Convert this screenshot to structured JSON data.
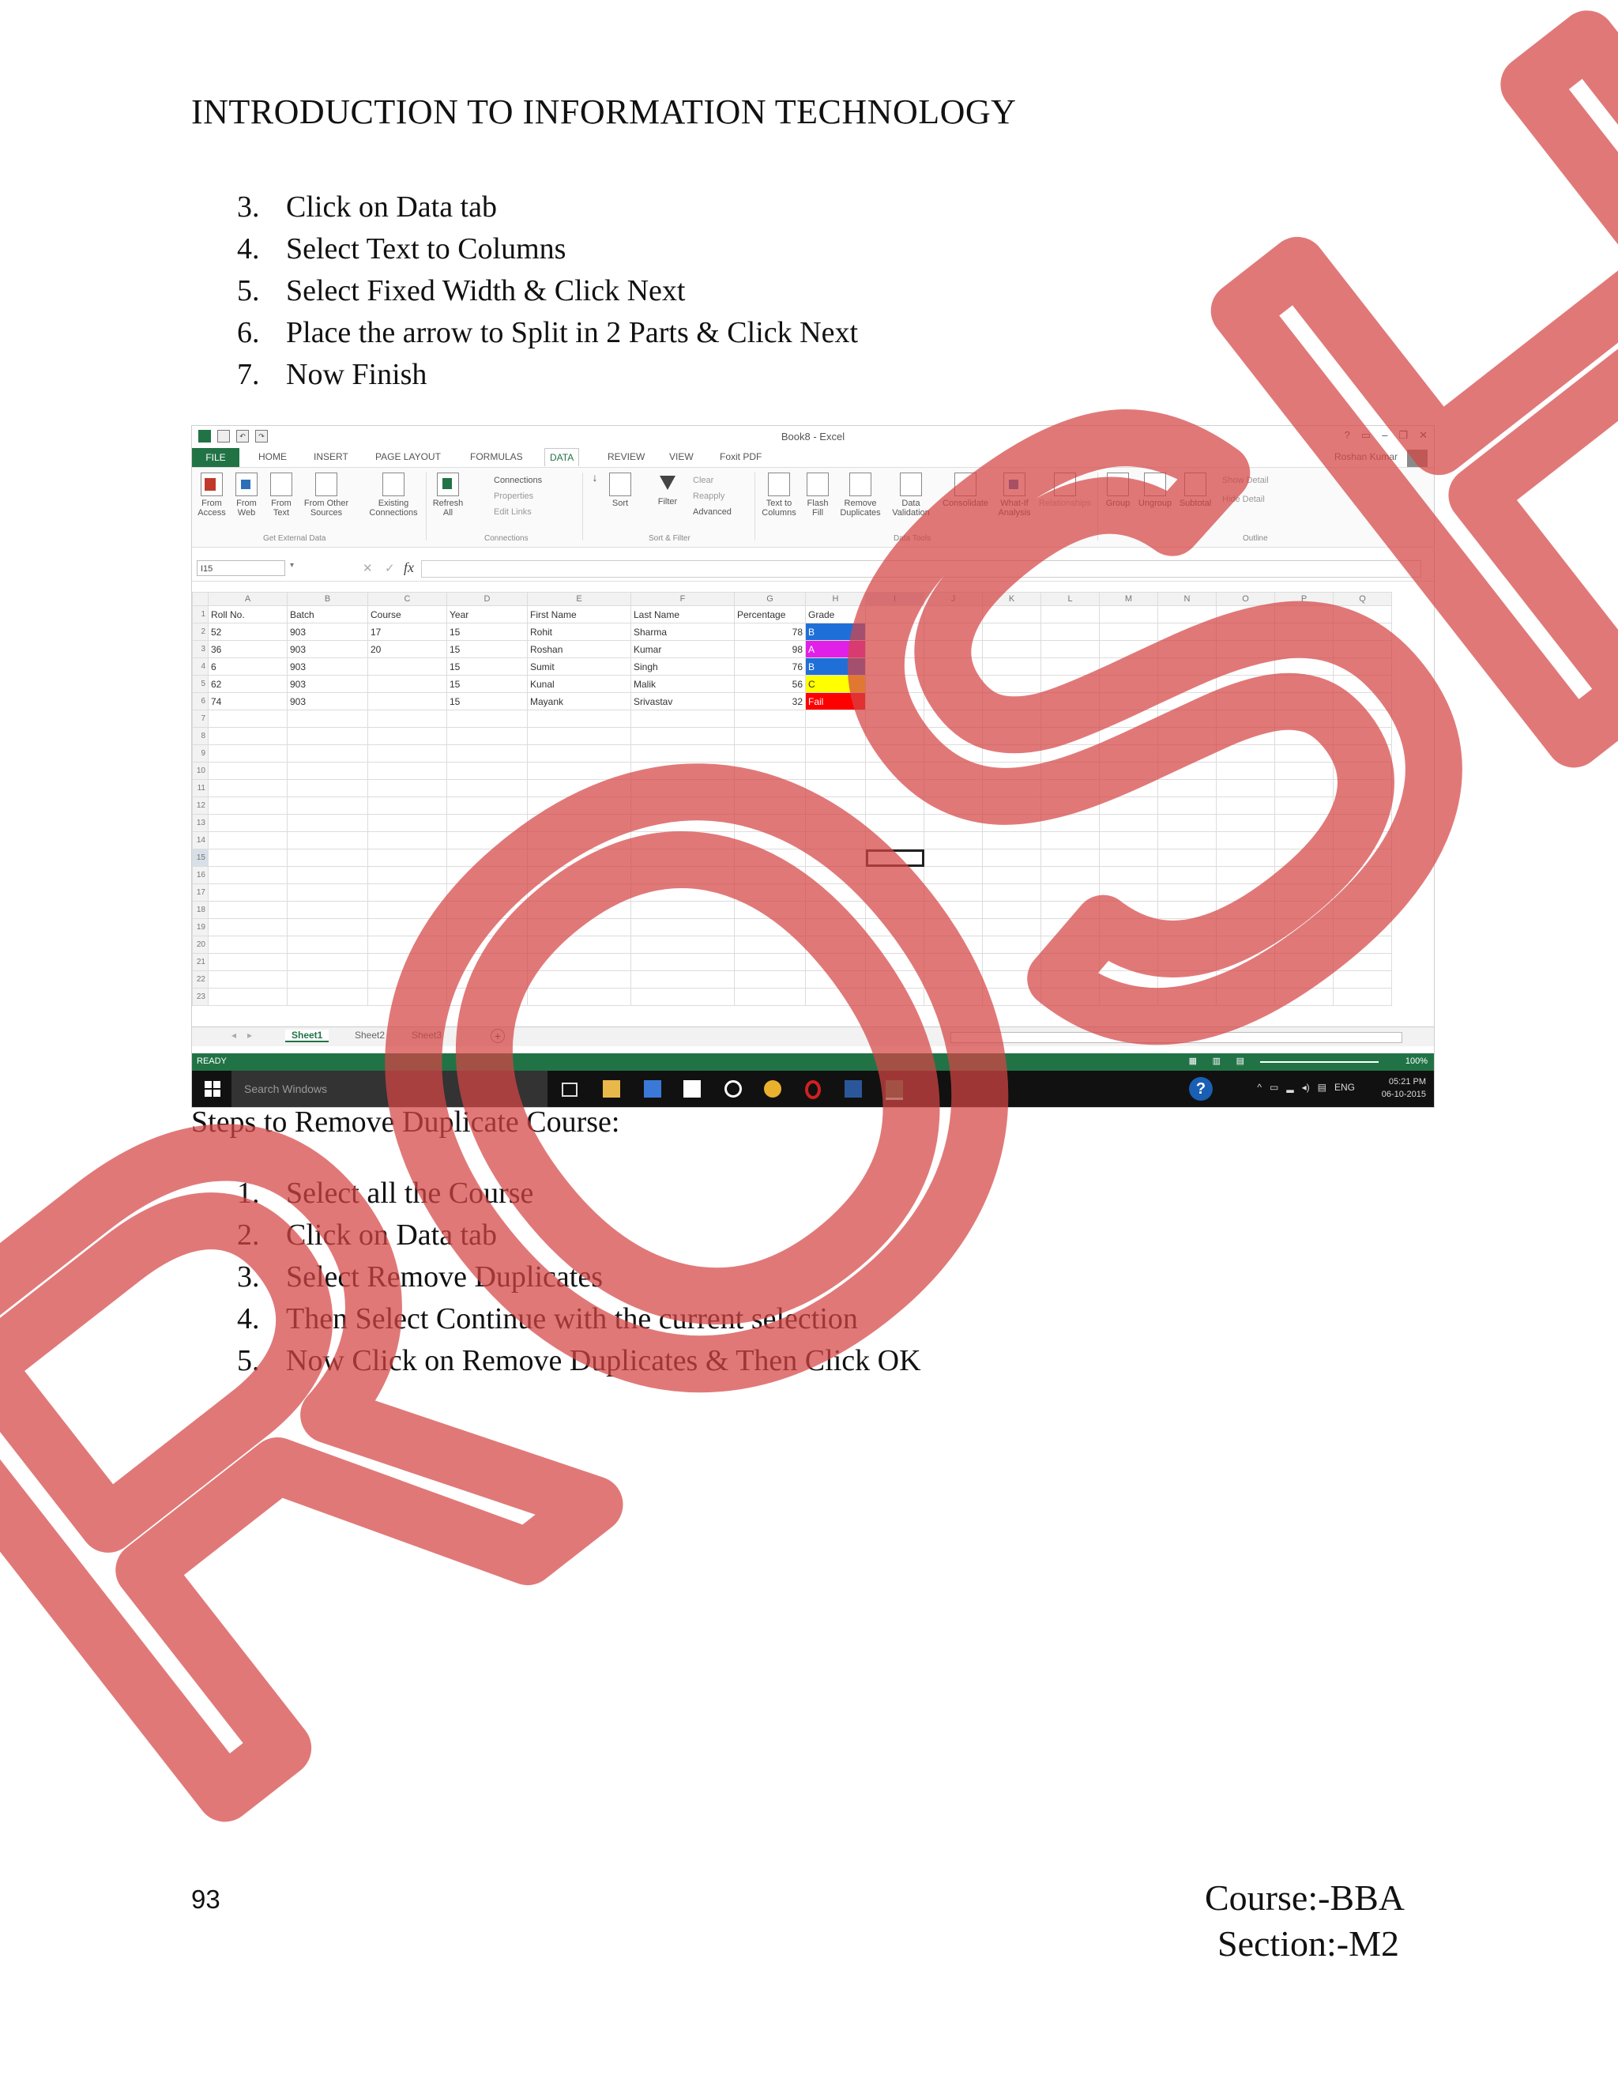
{
  "header": {
    "title": "INTRODUCTION TO INFORMATION TECHNOLOGY"
  },
  "steps_top": [
    {
      "num": "3.",
      "text": "Click  on Data tab"
    },
    {
      "num": "4.",
      "text": "Select Text to Columns"
    },
    {
      "num": "5.",
      "text": "Select Fixed  Width  & Click  Next"
    },
    {
      "num": "6.",
      "text": "Place  the arrow to Split  in 2 Parts & Click  Next"
    },
    {
      "num": "7.",
      "text": "Now Finish"
    }
  ],
  "excel": {
    "window_title": "Book8 - Excel",
    "user": "Roshan Kumar",
    "tabs": [
      "FILE",
      "HOME",
      "INSERT",
      "PAGE LAYOUT",
      "FORMULAS",
      "DATA",
      "REVIEW",
      "VIEW",
      "Foxit PDF"
    ],
    "active_tab": "DATA",
    "ribbon": {
      "from_access": "From Access",
      "from_web": "From Web",
      "from_text": "From Text",
      "from_other": "From Other Sources",
      "existing": "Existing Connections",
      "refresh": "Refresh All",
      "connections": "Connections",
      "properties": "Properties",
      "edit_links": "Edit Links",
      "sort": "Sort",
      "filter": "Filter",
      "clear": "Clear",
      "reapply": "Reapply",
      "advanced": "Advanced",
      "text_to_columns": "Text to Columns",
      "flash_fill": "Flash Fill",
      "remove_duplicates": "Remove Duplicates",
      "data_validation": "Data Validation",
      "consolidate": "Consolidate",
      "what_if": "What-If Analysis",
      "relationships": "Relationships",
      "group": "Group",
      "ungroup": "Ungroup",
      "subtotal": "Subtotal",
      "show_detail": "Show Detail",
      "hide_detail": "Hide Detail",
      "groups": {
        "external": "Get External Data",
        "connections": "Connections",
        "sort_filter": "Sort & Filter",
        "data_tools": "Data Tools",
        "outline": "Outline"
      }
    },
    "name_box": "I15",
    "columns": [
      "A",
      "B",
      "C",
      "D",
      "E",
      "F",
      "G",
      "H",
      "I",
      "J",
      "K",
      "L",
      "M",
      "N",
      "O",
      "P",
      "Q"
    ],
    "headers": [
      "Roll No.",
      "Batch",
      "Course",
      "Year",
      "First Name",
      "Last Name",
      "Percentage",
      "Grade"
    ],
    "rows": [
      {
        "roll": "52",
        "batch": "903",
        "course": "17",
        "year": "15",
        "first": "Rohit",
        "last": "Sharma",
        "pct": "78",
        "grade": "B"
      },
      {
        "roll": "36",
        "batch": "903",
        "course": "20",
        "year": "15",
        "first": "Roshan",
        "last": "Kumar",
        "pct": "98",
        "grade": "A"
      },
      {
        "roll": "6",
        "batch": "903",
        "course": "",
        "year": "15",
        "first": "Sumit",
        "last": "Singh",
        "pct": "76",
        "grade": "B"
      },
      {
        "roll": "62",
        "batch": "903",
        "course": "",
        "year": "15",
        "first": "Kunal",
        "last": "Malik",
        "pct": "56",
        "grade": "C"
      },
      {
        "roll": "74",
        "batch": "903",
        "course": "",
        "year": "15",
        "first": "Mayank",
        "last": "Srivastav",
        "pct": "32",
        "grade": "Fail"
      }
    ],
    "row_numbers": [
      "1",
      "2",
      "3",
      "4",
      "5",
      "6",
      "7",
      "8",
      "9",
      "10",
      "11",
      "12",
      "13",
      "14",
      "15",
      "16",
      "17",
      "18",
      "19",
      "20",
      "21",
      "22",
      "23"
    ],
    "sheets": [
      "Sheet1",
      "Sheet2",
      "Sheet3"
    ],
    "status": "READY",
    "zoom": "100%",
    "taskbar": {
      "search": "Search Windows",
      "time": "05:21 PM",
      "date": "06-10-2015",
      "lang": "ENG"
    },
    "grade_colors": {
      "A": "#e020e8",
      "B": "#1f6fd9",
      "C": "#ffff00",
      "Fail": "#ff0000"
    }
  },
  "section_heading": "Steps to Remove  Duplicate  Course:",
  "steps_bottom": [
    {
      "num": "1.",
      "text": "Select  all  the Course"
    },
    {
      "num": "2.",
      "text": "Click  on Data tab"
    },
    {
      "num": "3.",
      "text": "Select Remove  Duplicates"
    },
    {
      "num": "4.",
      "text": "Then Select Continue  with  the current  selection"
    },
    {
      "num": "5.",
      "text": "Now Click  on Remove  Duplicates  & Then Click  OK"
    }
  ],
  "watermark": {
    "text": "ROSHAN",
    "color": "#d64545"
  },
  "footer": {
    "page_number": "93",
    "course": "Course:-BBA",
    "section": "Section:-M2"
  }
}
